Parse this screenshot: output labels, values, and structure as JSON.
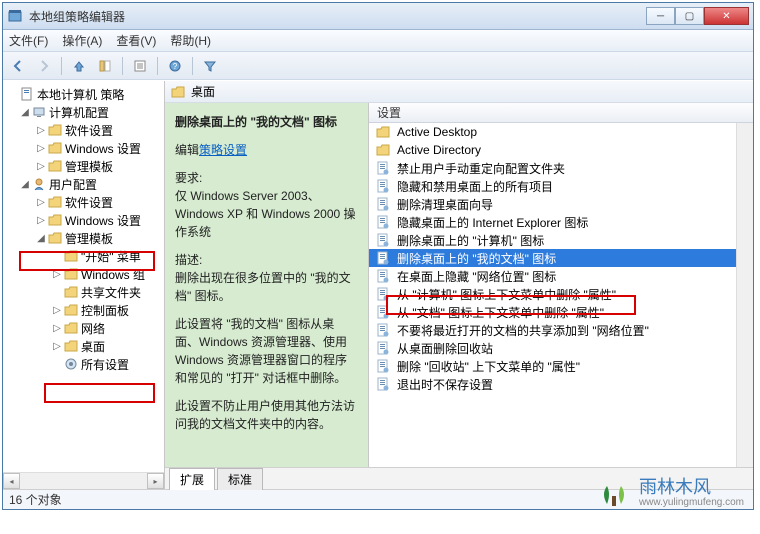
{
  "window": {
    "title": "本地组策略编辑器"
  },
  "menu": {
    "file": "文件(F)",
    "action": "操作(A)",
    "view": "查看(V)",
    "help": "帮助(H)"
  },
  "tree": {
    "root": "本地计算机 策略",
    "computer_config": "计算机配置",
    "cc_software": "软件设置",
    "cc_windows": "Windows 设置",
    "cc_templates": "管理模板",
    "user_config": "用户配置",
    "uc_software": "软件设置",
    "uc_windows": "Windows 设置",
    "uc_templates": "管理模板",
    "start_menu": "\"开始\" 菜单",
    "windows_components": "Windows 组",
    "shared_folders": "共享文件夹",
    "control_panel": "控制面板",
    "network": "网络",
    "desktop": "桌面",
    "all_settings": "所有设置"
  },
  "right": {
    "header": "桌面",
    "desc": {
      "title": "删除桌面上的 \"我的文档\" 图标",
      "edit_label": "编辑",
      "policy_link": "策略设置",
      "req_label": "要求:",
      "req_text": "仅 Windows Server 2003、Windows XP 和 Windows 2000 操作系统",
      "desc_label": "描述:",
      "desc_p1": "删除出现在很多位置中的 \"我的文档\" 图标。",
      "desc_p2": "此设置将 \"我的文档\" 图标从桌面、Windows 资源管理器、使用 Windows 资源管理器窗口的程序和常见的 \"打开\" 对话框中删除。",
      "desc_p3": "此设置不防止用户使用其他方法访问我的文档文件夹中的内容。"
    },
    "list_header": "设置",
    "items": [
      {
        "type": "folder",
        "label": "Active Desktop"
      },
      {
        "type": "folder",
        "label": "Active Directory"
      },
      {
        "type": "policy",
        "label": "禁止用户手动重定向配置文件夹"
      },
      {
        "type": "policy",
        "label": "隐藏和禁用桌面上的所有项目"
      },
      {
        "type": "policy",
        "label": "删除清理桌面向导"
      },
      {
        "type": "policy",
        "label": "隐藏桌面上的 Internet Explorer 图标"
      },
      {
        "type": "policy",
        "label": "删除桌面上的 \"计算机\" 图标"
      },
      {
        "type": "policy",
        "label": "删除桌面上的 \"我的文档\" 图标",
        "selected": true
      },
      {
        "type": "policy",
        "label": "在桌面上隐藏 \"网络位置\" 图标"
      },
      {
        "type": "policy",
        "label": "从 \"计算机\" 图标上下文菜单中删除 \"属性\""
      },
      {
        "type": "policy",
        "label": "从 \"文档\" 图标上下文菜单中删除 \"属性\""
      },
      {
        "type": "policy",
        "label": "不要将最近打开的文档的共享添加到 \"网络位置\""
      },
      {
        "type": "policy",
        "label": "从桌面删除回收站"
      },
      {
        "type": "policy",
        "label": "删除 \"回收站\" 上下文菜单的 \"属性\""
      },
      {
        "type": "policy",
        "label": "退出时不保存设置"
      }
    ],
    "tabs": {
      "extended": "扩展",
      "standard": "标准"
    }
  },
  "status": {
    "count": "16 个对象"
  },
  "watermark": {
    "brand": "雨林木风",
    "url": "www.yulingmufeng.com"
  }
}
